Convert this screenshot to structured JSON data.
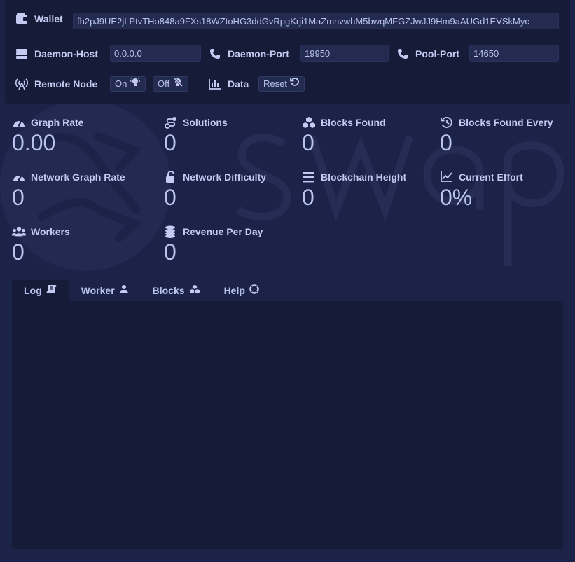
{
  "theme": {
    "bg": "#1b2348",
    "panel": "#161c38",
    "text": "#b9c3ee"
  },
  "config": {
    "wallet": {
      "label": "Wallet",
      "icon": "wallet-icon",
      "value": "fh2pJ9UE2jLPtvTHo848a9FXs18WZtoHG3ddGvRpgKrji1MaZmnvwhM5bwqMFGZJwJJ9Hm9aAUGd1EVSkMyc"
    },
    "daemon_host": {
      "label": "Daemon-Host",
      "icon": "server-icon",
      "value": "0.0.0.0"
    },
    "daemon_port": {
      "label": "Daemon-Port",
      "icon": "phone-icon",
      "value": "19950"
    },
    "pool_port": {
      "label": "Pool-Port",
      "icon": "phone-icon",
      "value": "14650"
    },
    "remote_node": {
      "label": "Remote Node",
      "icon": "antenna-icon",
      "on_label": "On",
      "off_label": "Off"
    },
    "data": {
      "label": "Data",
      "icon": "bar-chart-icon",
      "reset_label": "Reset"
    }
  },
  "stats": [
    {
      "label": "Graph Rate",
      "icon": "gauge-icon",
      "value": "0.00"
    },
    {
      "label": "Solutions",
      "icon": "route-icon",
      "value": "0"
    },
    {
      "label": "Blocks Found",
      "icon": "cubes-icon",
      "value": "0"
    },
    {
      "label": "Blocks Found Every",
      "icon": "history-icon",
      "value": "0"
    },
    {
      "label": "Network Graph Rate",
      "icon": "gauge-icon",
      "value": "0"
    },
    {
      "label": "Network Difficulty",
      "icon": "unlock-icon",
      "value": "0"
    },
    {
      "label": "Blockchain Height",
      "icon": "bars-icon",
      "value": "0"
    },
    {
      "label": "Current Effort",
      "icon": "line-chart-icon",
      "value": "0%"
    },
    {
      "label": "Workers",
      "icon": "users-icon",
      "value": "0"
    },
    {
      "label": "Revenue Per Day",
      "icon": "coins-icon",
      "value": "0"
    }
  ],
  "tabs": [
    {
      "label": "Log",
      "icon": "scroll-icon",
      "active": true
    },
    {
      "label": "Worker",
      "icon": "user-icon",
      "active": false
    },
    {
      "label": "Blocks",
      "icon": "cubes-icon",
      "active": false
    },
    {
      "label": "Help",
      "icon": "life-ring-icon",
      "active": false
    }
  ]
}
